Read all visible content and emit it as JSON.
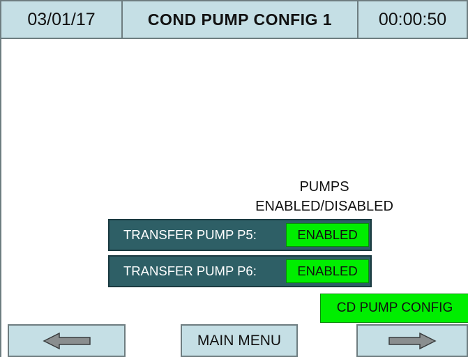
{
  "header": {
    "date": "03/01/17",
    "title": "COND PUMP CONFIG 1",
    "time": "00:00:50"
  },
  "column_title": {
    "line1": "PUMPS",
    "line2": "ENABLED/DISABLED"
  },
  "pumps": [
    {
      "label": "TRANSFER PUMP  P5:",
      "state": "ENABLED"
    },
    {
      "label": "TRANSFER PUMP  P6:",
      "state": "ENABLED"
    }
  ],
  "cd_pump_config_label": "CD PUMP CONFIG",
  "nav": {
    "back_icon": "left-arrow-icon",
    "main_menu_label": "MAIN MENU",
    "forward_icon": "right-arrow-icon"
  },
  "colors": {
    "header_bg": "#c5dfe5",
    "row_bg": "#2e5f66",
    "enabled": "#00ee00"
  }
}
